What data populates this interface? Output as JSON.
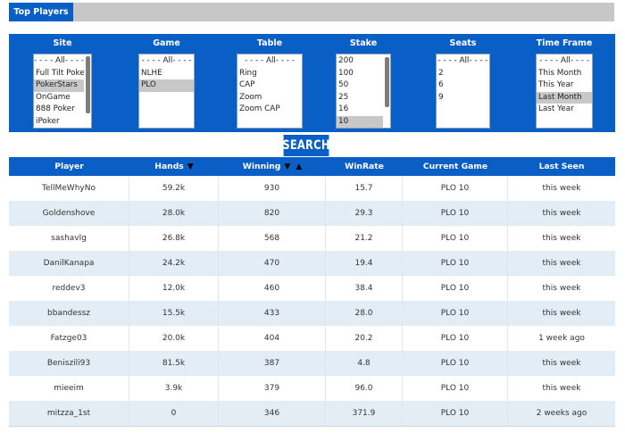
{
  "header": {
    "tab_label": "Top Players"
  },
  "filters": [
    {
      "key": "site",
      "label": "Site",
      "options": [
        "- - - - All- - - -",
        "Full Tilt Poker",
        "PokerStars",
        "OnGame",
        "888 Poker",
        "iPoker"
      ],
      "selected": [
        2
      ]
    },
    {
      "key": "game",
      "label": "Game",
      "options": [
        "- - - - All- - - -",
        "NLHE",
        "PLO"
      ],
      "selected": [
        2
      ]
    },
    {
      "key": "table",
      "label": "Table",
      "options": [
        "- - - - All- - - -",
        "Ring",
        "CAP",
        "Zoom",
        "Zoom CAP"
      ],
      "selected": []
    },
    {
      "key": "stake",
      "label": "Stake",
      "options": [
        "200",
        "100",
        "50",
        "25",
        "16",
        "10"
      ],
      "selected": [
        5
      ]
    },
    {
      "key": "seats",
      "label": "Seats",
      "options": [
        "- - - - All- - - -",
        "2",
        "6",
        "9"
      ],
      "selected": []
    },
    {
      "key": "time_frame",
      "label": "Time Frame",
      "options": [
        "- - - - All- - - -",
        "This Month",
        "This Year",
        "Last Month",
        "Last Year"
      ],
      "selected": [
        3
      ]
    }
  ],
  "search_label": "SEARCH",
  "table": {
    "columns": [
      "Player",
      "Hands",
      "Winning",
      "WinRate",
      "Current Game",
      "Last Seen"
    ],
    "rows": [
      [
        "TellMeWhyNo",
        "59.2k",
        "930",
        "15.7",
        "PLO 10",
        "this week"
      ],
      [
        "Goldenshove",
        "28.0k",
        "820",
        "29.3",
        "PLO 10",
        "this week"
      ],
      [
        "sashavlg",
        "26.8k",
        "568",
        "21.2",
        "PLO 10",
        "this week"
      ],
      [
        "DanilKanapa",
        "24.2k",
        "470",
        "19.4",
        "PLO 10",
        "this week"
      ],
      [
        "reddev3",
        "12.0k",
        "460",
        "38.4",
        "PLO 10",
        "this week"
      ],
      [
        "bbandessz",
        "15.5k",
        "433",
        "28.0",
        "PLO 10",
        "this week"
      ],
      [
        "Fatzge03",
        "20.0k",
        "404",
        "20.2",
        "PLO 10",
        "1 week ago"
      ],
      [
        "Beniszili93",
        "81.5k",
        "387",
        "4.8",
        "PLO 10",
        "this week"
      ],
      [
        "mieeim",
        "3.9k",
        "379",
        "96.0",
        "PLO 10",
        "this week"
      ],
      [
        "mitzza_1st",
        "0",
        "346",
        "371.9",
        "PLO 10",
        "2 weeks ago"
      ]
    ]
  },
  "icons": {
    "sort_desc": "triangle-down-icon",
    "sort_asc": "triangle-up-icon"
  },
  "colors": {
    "accent": "#0a5fc6",
    "row_alt": "#e3edf5",
    "selected_option": "#c8c8c8"
  }
}
